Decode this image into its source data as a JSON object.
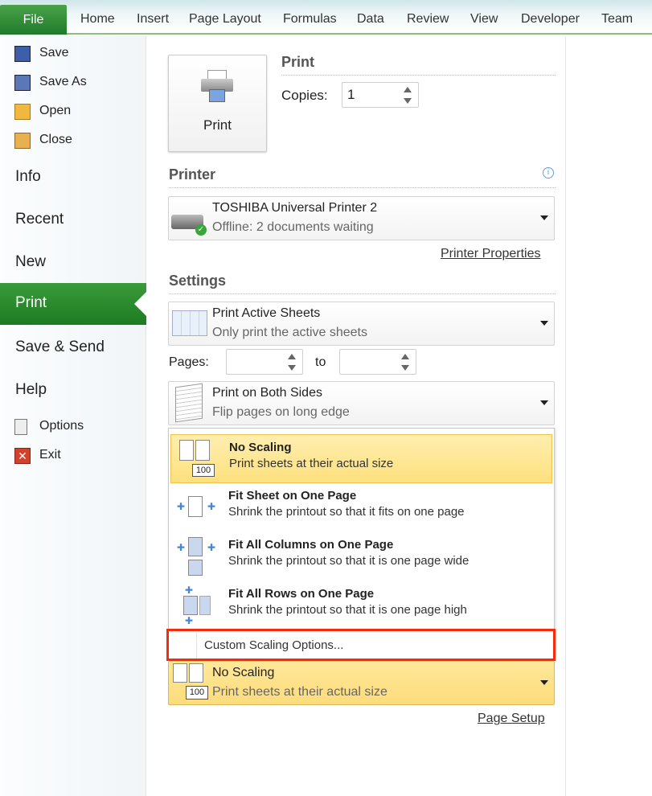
{
  "tabs": {
    "file": "File",
    "items": [
      "Home",
      "Insert",
      "Page Layout",
      "Formulas",
      "Data",
      "Review",
      "View",
      "Developer",
      "Team"
    ]
  },
  "sidebar": {
    "small_top": [
      {
        "label": "Save",
        "icon": "save-icon"
      },
      {
        "label": "Save As",
        "icon": "save-as-icon"
      },
      {
        "label": "Open",
        "icon": "open-folder-icon"
      },
      {
        "label": "Close",
        "icon": "close-folder-icon"
      }
    ],
    "big": [
      "Info",
      "Recent",
      "New",
      "Print",
      "Save & Send",
      "Help"
    ],
    "selected": "Print",
    "small_bottom": [
      {
        "label": "Options",
        "icon": "options-icon"
      },
      {
        "label": "Exit",
        "icon": "exit-icon"
      }
    ]
  },
  "print": {
    "button_label": "Print",
    "heading": "Print",
    "copies_label": "Copies:",
    "copies_value": "1"
  },
  "printer": {
    "heading": "Printer",
    "name": "TOSHIBA Universal Printer 2",
    "status": "Offline: 2 documents waiting",
    "properties_link": "Printer Properties"
  },
  "settings": {
    "heading": "Settings",
    "what": {
      "title": "Print Active Sheets",
      "sub": "Only print the active sheets"
    },
    "pages_label": "Pages:",
    "to_label": "to",
    "pages_from": "",
    "pages_to": "",
    "sides": {
      "title": "Print on Both Sides",
      "sub": "Flip pages on long edge"
    },
    "scaling_menu": [
      {
        "title": "No Scaling",
        "sub": "Print sheets at their actual size",
        "selected": true
      },
      {
        "title": "Fit Sheet on One Page",
        "sub": "Shrink the printout so that it fits on one page"
      },
      {
        "title": "Fit All Columns on One Page",
        "sub": "Shrink the printout so that it is one page wide"
      },
      {
        "title": "Fit All Rows on One Page",
        "sub": "Shrink the printout so that it is one page high"
      }
    ],
    "custom_scaling": "Custom Scaling Options...",
    "scaling_current": {
      "title": "No Scaling",
      "sub": "Print sheets at their actual size",
      "badge": "100"
    },
    "page_setup_link": "Page Setup"
  },
  "colors": {
    "accent_green": "#1f7a2a",
    "highlight_yellow": "#fde07d",
    "callout_red": "#f52a0e"
  }
}
